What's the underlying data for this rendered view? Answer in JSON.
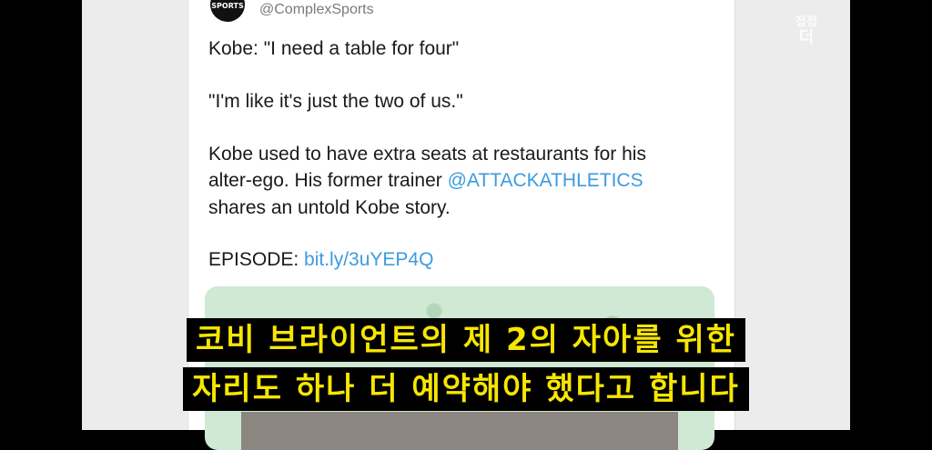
{
  "tweet": {
    "avatar_text": "SPORTS",
    "handle": "@ComplexSports",
    "line1": "Kobe: \"I need a table for four\"",
    "line2": "\"I'm like it's just the two of us.\"",
    "line3": "Kobe used to have extra seats at restaurants for his",
    "line4": "alter-ego. His former trainer ",
    "mention": "@ATTACKATHLETICS",
    "line5": "shares an untold Kobe story.",
    "episode_label": "EPISODE: ",
    "episode_link": "bit.ly/3uYEP4Q"
  },
  "watermark": {
    "top": "접접",
    "bottom": "더"
  },
  "subtitles": {
    "line1": "코비 브라이언트의 제 2의 자아를 위한",
    "line2": "자리도 하나 더 예약해야 했다고 합니다"
  },
  "colors": {
    "link": "#3d9be0",
    "subtitle_text": "#f7e600",
    "media_bg": "#cfe9d4"
  }
}
